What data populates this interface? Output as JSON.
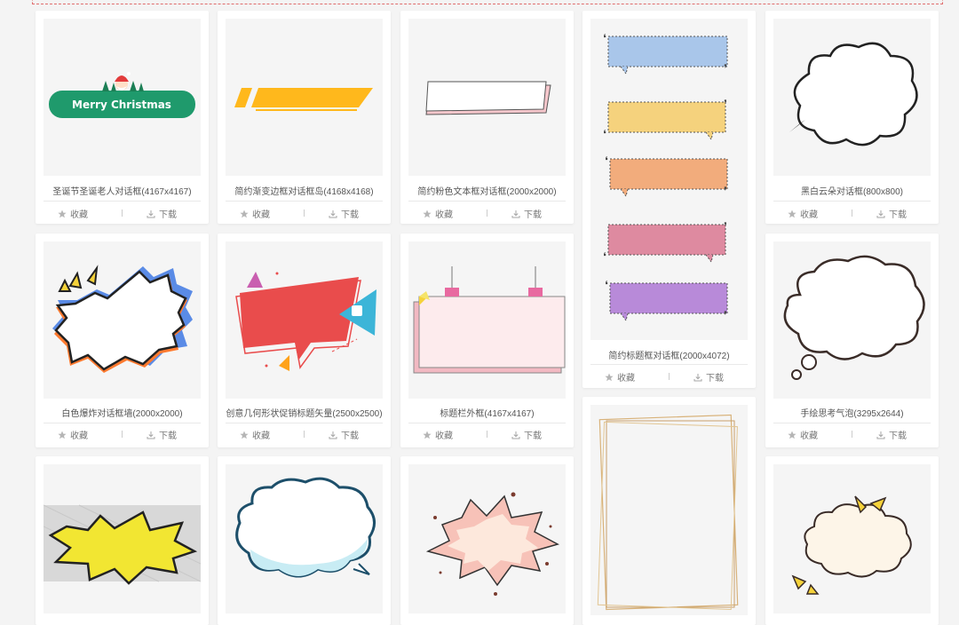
{
  "action_labels": {
    "favorite": "收藏",
    "download": "下载"
  },
  "cards": [
    {
      "title": "圣诞节圣诞老人对话框(4167x4167)"
    },
    {
      "title": "简约渐变边框对话框岛(4168x4168)"
    },
    {
      "title": "简约粉色文本框对话框(2000x2000)"
    },
    {
      "title": "简约标题框对话框(2000x4072)"
    },
    {
      "title": "黑白云朵对话框(800x800)"
    },
    {
      "title": "白色爆炸对话框墙(2000x2000)"
    },
    {
      "title": "创意几何形状促销标题矢量(2500x2500)"
    },
    {
      "title": "标题栏外框(4167x4167)"
    },
    {
      "title": "手绘思考气泡(3295x2644)"
    },
    {
      "title": ""
    },
    {
      "title": ""
    },
    {
      "title": ""
    },
    {
      "title": ""
    },
    {
      "title": ""
    }
  ],
  "thumb_texts": {
    "christmas_banner": "Merry Christmas"
  },
  "colors": {
    "background": "#f4f4f4",
    "christmas_green": "#1f9a6c",
    "gradient_yellow": "#ffb81c",
    "explosion_red": "#e94c4c",
    "thumb_blue": "#3cb5d8"
  }
}
